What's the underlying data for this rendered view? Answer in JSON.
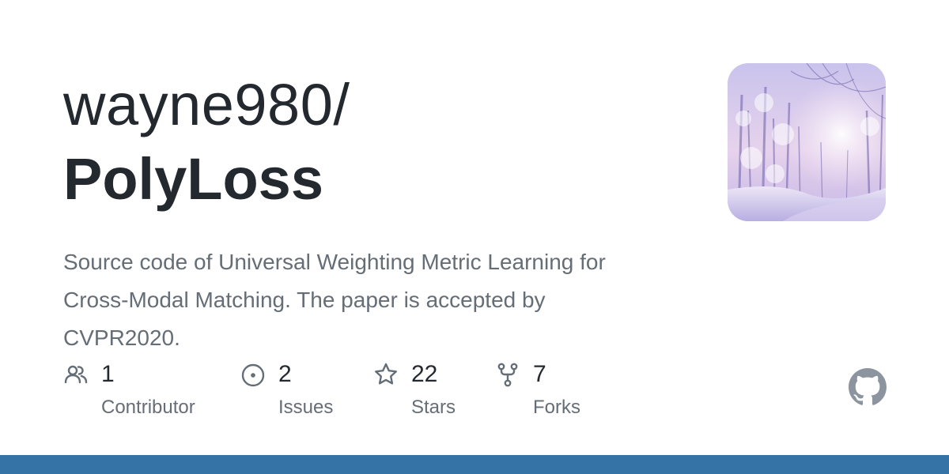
{
  "repo": {
    "owner": "wayne980/",
    "name": "PolyLoss",
    "description": "Source code of Universal Weighting Metric Learning for Cross-Modal Matching. The paper is accepted by CVPR2020."
  },
  "stats": [
    {
      "value": "1",
      "label": "Contributor",
      "icon": "people-icon"
    },
    {
      "value": "2",
      "label": "Issues",
      "icon": "issue-opened-icon"
    },
    {
      "value": "22",
      "label": "Stars",
      "icon": "star-icon"
    },
    {
      "value": "7",
      "label": "Forks",
      "icon": "repo-forked-icon"
    }
  ],
  "colors": {
    "text_primary": "#24292f",
    "text_secondary": "#656d76",
    "language_bar": "#3572a5",
    "logo": "#8c959f"
  }
}
